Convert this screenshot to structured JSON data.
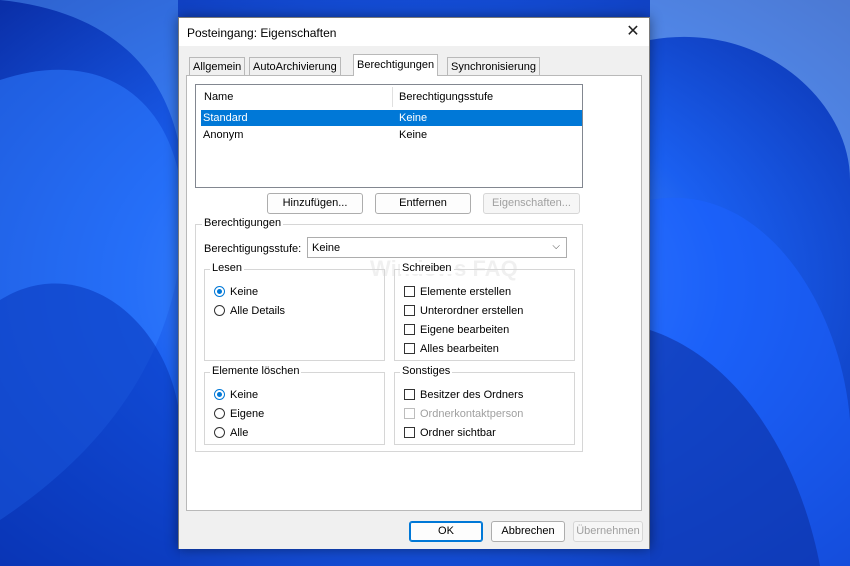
{
  "dialog": {
    "title": "Posteingang: Eigenschaften",
    "close_glyph": "✕"
  },
  "tabs": [
    {
      "label": "Allgemein"
    },
    {
      "label": "AutoArchivierung"
    },
    {
      "label": "Berechtigungen"
    },
    {
      "label": "Synchronisierung"
    }
  ],
  "list": {
    "headers": [
      "Name",
      "Berechtigungsstufe"
    ],
    "rows": [
      {
        "name": "Standard",
        "level": "Keine",
        "selected": true
      },
      {
        "name": "Anonym",
        "level": "Keine",
        "selected": false
      }
    ]
  },
  "list_buttons": {
    "add": "Hinzufügen...",
    "remove": "Entfernen",
    "properties": "Eigenschaften..."
  },
  "permissions": {
    "group_label": "Berechtigungen",
    "level_label": "Berechtigungsstufe:",
    "level_value": "Keine",
    "read": {
      "label": "Lesen",
      "options": [
        {
          "label": "Keine",
          "checked": true
        },
        {
          "label": "Alle Details",
          "checked": false
        }
      ]
    },
    "write": {
      "label": "Schreiben",
      "options": [
        {
          "label": "Elemente erstellen",
          "checked": false
        },
        {
          "label": "Unterordner erstellen",
          "checked": false
        },
        {
          "label": "Eigene bearbeiten",
          "checked": false
        },
        {
          "label": "Alles bearbeiten",
          "checked": false
        }
      ]
    },
    "delete": {
      "label": "Elemente löschen",
      "options": [
        {
          "label": "Keine",
          "checked": true
        },
        {
          "label": "Eigene",
          "checked": false
        },
        {
          "label": "Alle",
          "checked": false
        }
      ]
    },
    "other": {
      "label": "Sonstiges",
      "options": [
        {
          "label": "Besitzer des Ordners",
          "checked": false,
          "disabled": false
        },
        {
          "label": "Ordnerkontaktperson",
          "checked": false,
          "disabled": true
        },
        {
          "label": "Ordner sichtbar",
          "checked": false,
          "disabled": false
        }
      ]
    }
  },
  "watermark": "Windows FAQ",
  "footer": {
    "ok": "OK",
    "cancel": "Abbrechen",
    "apply": "Übernehmen"
  },
  "colors": {
    "accent": "#0078d7",
    "wallpaper": "#0b3fd6"
  }
}
